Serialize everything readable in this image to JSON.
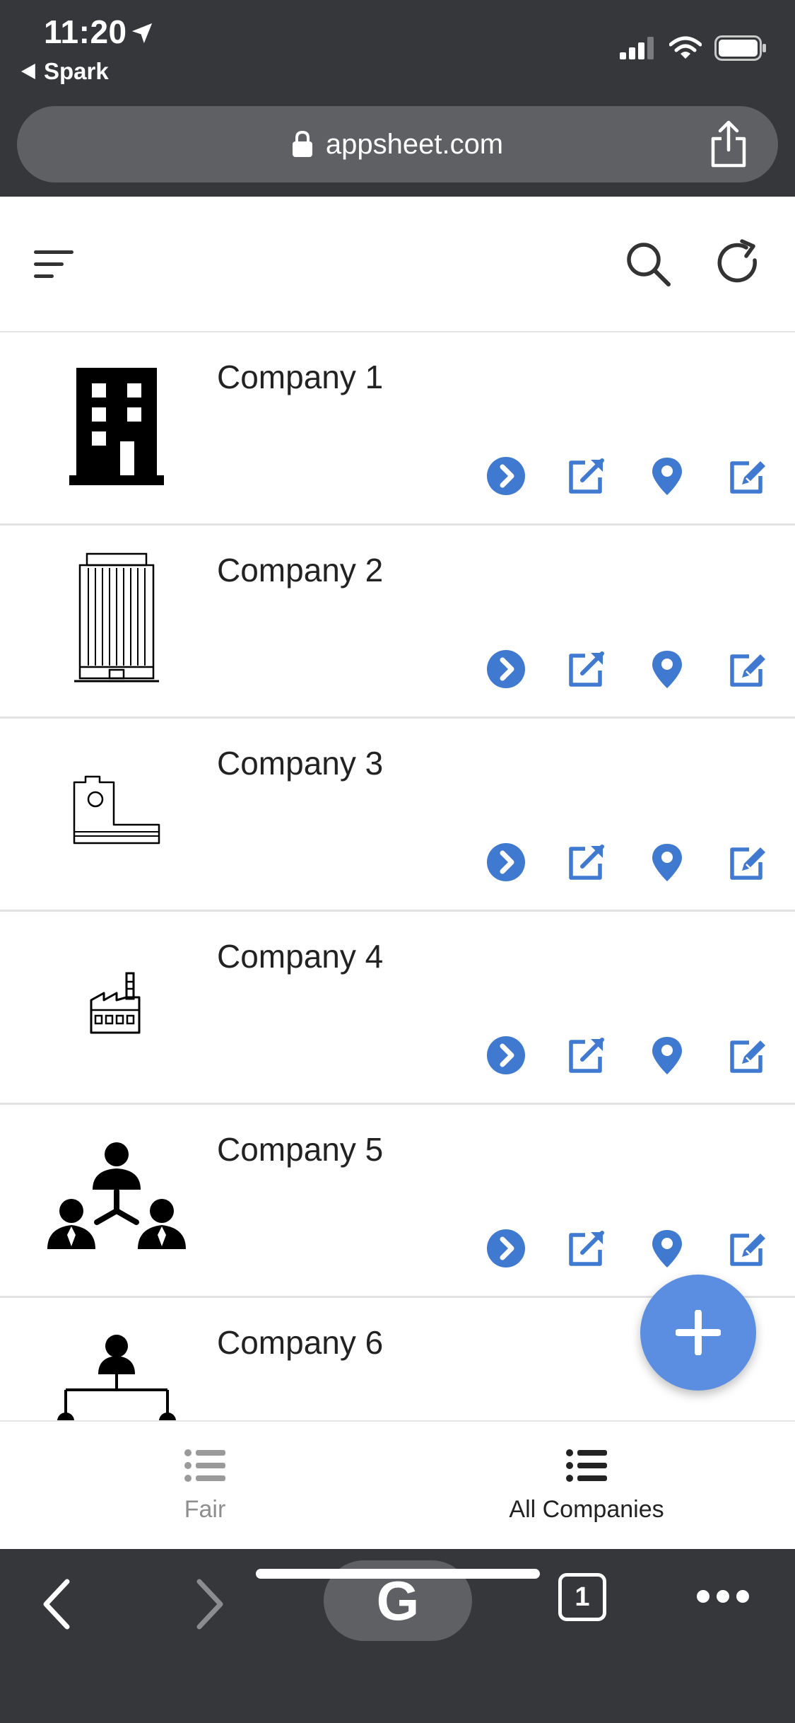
{
  "status_bar": {
    "time": "11:20",
    "back_app": "Spark"
  },
  "browser": {
    "url": "appsheet.com",
    "tab_count": "1",
    "google_label": "G"
  },
  "colors": {
    "accent": "#3f7ad0",
    "chrome": "#36373b",
    "fab": "#5b8ee0"
  },
  "companies": [
    {
      "name": "Company 1",
      "icon": "office-building-icon"
    },
    {
      "name": "Company 2",
      "icon": "skyscraper-icon"
    },
    {
      "name": "Company 3",
      "icon": "low-building-icon"
    },
    {
      "name": "Company 4",
      "icon": "factory-icon"
    },
    {
      "name": "Company 5",
      "icon": "people-network-icon"
    },
    {
      "name": "Company 6",
      "icon": "org-chart-icon"
    }
  ],
  "row_actions": [
    "chevron-right-circle-icon",
    "external-link-icon",
    "map-pin-icon",
    "edit-icon"
  ],
  "tabs": [
    {
      "label": "Fair",
      "active": false
    },
    {
      "label": "All Companies",
      "active": true
    }
  ]
}
